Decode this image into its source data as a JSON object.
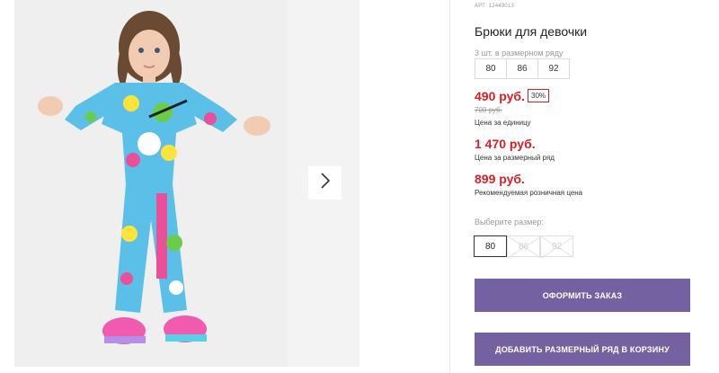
{
  "product": {
    "article": "АРТ: 12449013",
    "title": "Брюки для девочки",
    "set_label": "3 шт. в размерном ряду",
    "set_sizes": [
      "80",
      "86",
      "92"
    ],
    "price_unit": "490 руб.",
    "discount": "30%",
    "price_old": "700 руб.",
    "price_unit_label": "Цена за единицу",
    "price_row": "1 470 руб.",
    "price_row_label": "Цена за размерный ряд",
    "price_rrp": "899 руб.",
    "price_rrp_label": "Рекомендуемая розничная цена",
    "choose_size_label": "Выберите размер:",
    "size_options": [
      {
        "label": "80",
        "state": "selected"
      },
      {
        "label": "86",
        "state": "unavailable"
      },
      {
        "label": "92",
        "state": "unavailable"
      }
    ]
  },
  "actions": {
    "order_label": "ОФОРМИТЬ ЗАКАЗ",
    "add_row_label": "ДОБАВИТЬ РАЗМЕРНЫЙ РЯД В КОРЗИНУ"
  },
  "colors": {
    "accent": "#7461a1",
    "price": "#d61f26"
  },
  "icons": {
    "next": "chevron-right-icon"
  }
}
